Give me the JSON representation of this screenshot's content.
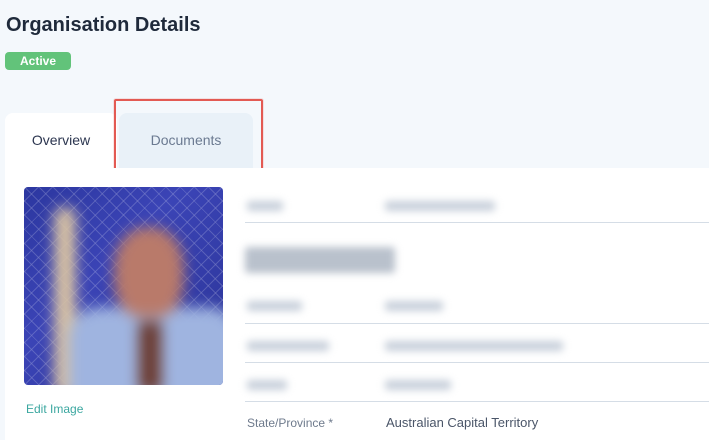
{
  "header": {
    "title": "Organisation Details",
    "status": "Active"
  },
  "tabs": [
    {
      "label": "Overview",
      "active": true
    },
    {
      "label": "Documents",
      "active": false
    }
  ],
  "profile": {
    "edit_image_label": "Edit Image"
  },
  "form": {
    "state_label": "State/Province *",
    "state_value": "Australian Capital Territory"
  },
  "colors": {
    "status_badge": "#62c37a",
    "highlight": "#e35a53",
    "link": "#3ba7a0"
  }
}
